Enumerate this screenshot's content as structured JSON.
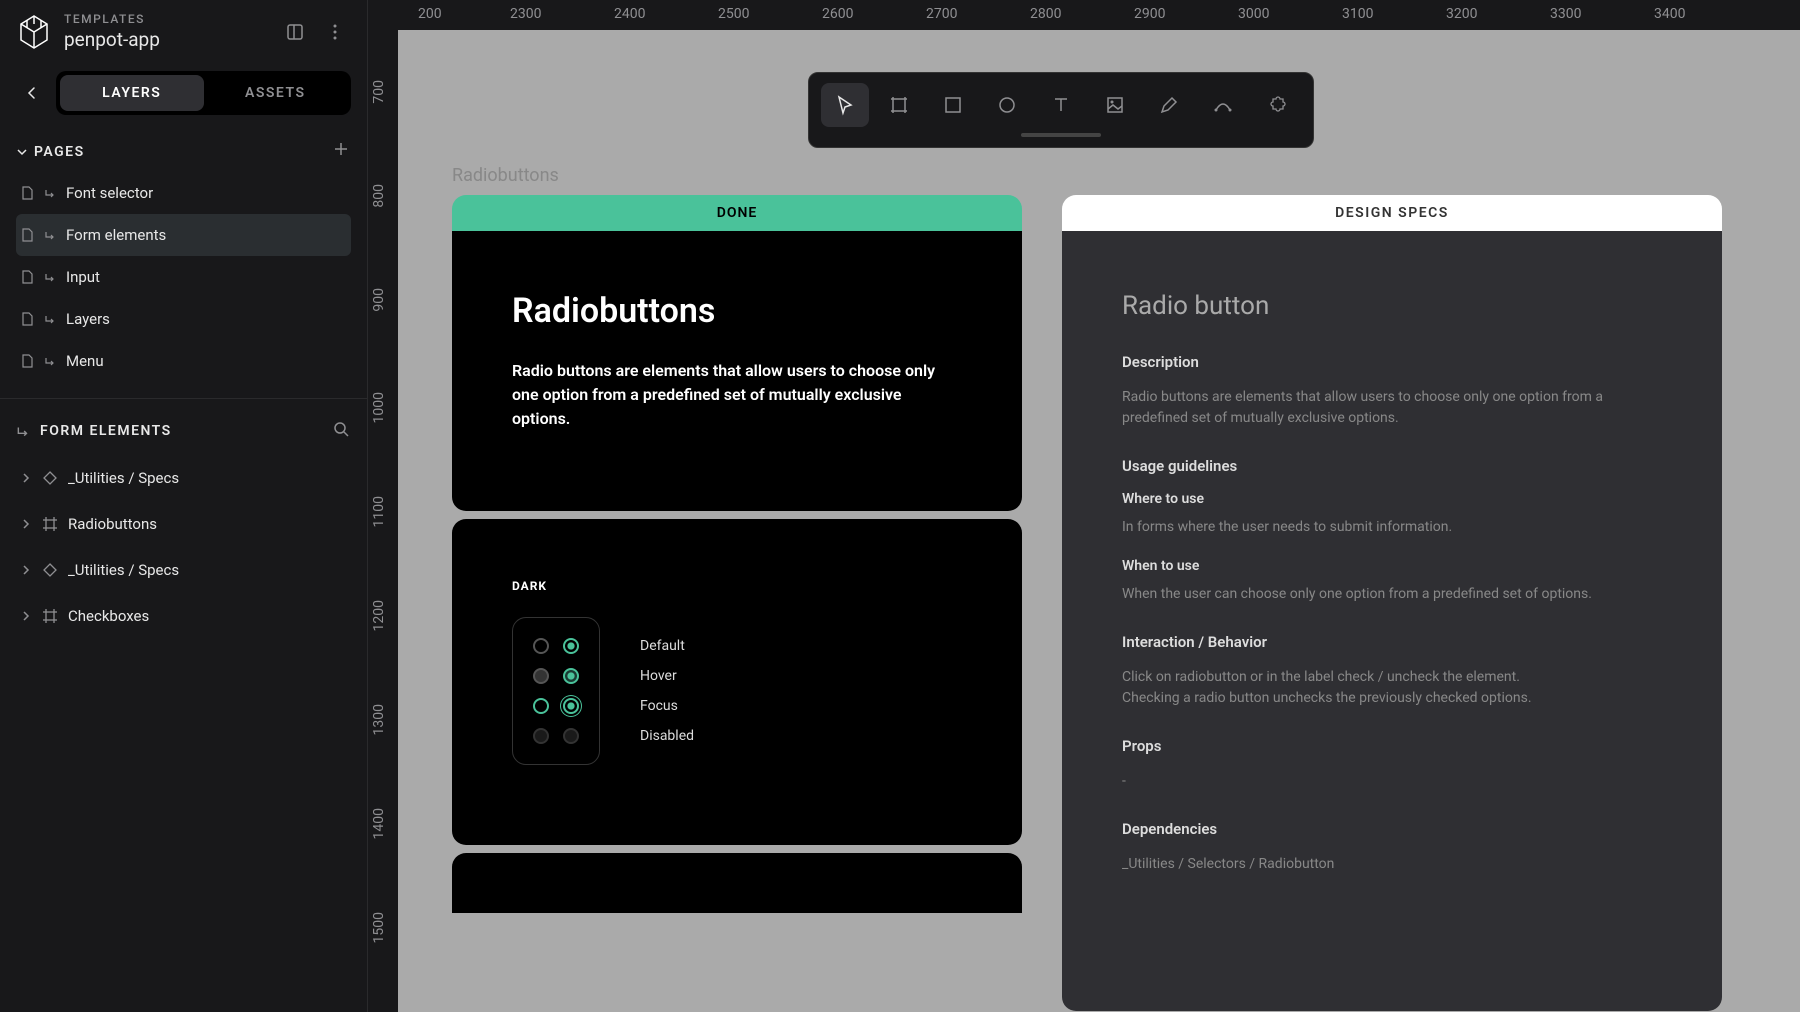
{
  "header": {
    "templates_label": "TEMPLATES",
    "project_name": "penpot-app"
  },
  "tabs": {
    "layers": "LAYERS",
    "assets": "ASSETS"
  },
  "pages": {
    "title": "PAGES",
    "items": [
      {
        "label": "Font selector"
      },
      {
        "label": "Form elements"
      },
      {
        "label": "Input"
      },
      {
        "label": "Layers"
      },
      {
        "label": "Menu"
      }
    ]
  },
  "layers_panel": {
    "title": "FORM ELEMENTS",
    "items": [
      {
        "label": "_Utilities / Specs",
        "icon": "component"
      },
      {
        "label": "Radiobuttons",
        "icon": "frame"
      },
      {
        "label": "_Utilities / Specs",
        "icon": "component"
      },
      {
        "label": "Checkboxes",
        "icon": "frame"
      }
    ]
  },
  "ruler_h": [
    "200",
    "2300",
    "2400",
    "2500",
    "2600",
    "2700",
    "2800",
    "2900",
    "3000",
    "3100",
    "3200",
    "3300",
    "3400"
  ],
  "ruler_v": [
    "700",
    "800",
    "900",
    "1000",
    "1100",
    "1200",
    "1300",
    "1400",
    "1500"
  ],
  "canvas": {
    "frame_label": "Radiobuttons",
    "done_label": "DONE",
    "design_specs_label": "DESIGN SPECS",
    "left_frame": {
      "title": "Radiobuttons",
      "description": "Radio buttons are elements that allow users to choose only one option from a predefined set of mutually exclusive options.",
      "demo_label": "DARK",
      "states": [
        "Default",
        "Hover",
        "Focus",
        "Disabled"
      ]
    },
    "specs": {
      "title": "Radio button",
      "description_heading": "Description",
      "description_text": "Radio buttons are elements that allow users to choose only one option from a predefined set of mutually exclusive options.",
      "usage_heading": "Usage guidelines",
      "where_heading": "Where to use",
      "where_text": "In forms where the user needs to submit information.",
      "when_heading": "When to use",
      "when_text": "When the user can choose only one option from a predefined set of options.",
      "interaction_heading": "Interaction / Behavior",
      "interaction_text1": "Click on radiobutton or in the label check / uncheck the element.",
      "interaction_text2": "Checking a radio button unchecks the previously checked options.",
      "props_heading": "Props",
      "props_text": "-",
      "deps_heading": "Dependencies",
      "deps_text": "_Utilities / Selectors / Radiobutton"
    }
  }
}
